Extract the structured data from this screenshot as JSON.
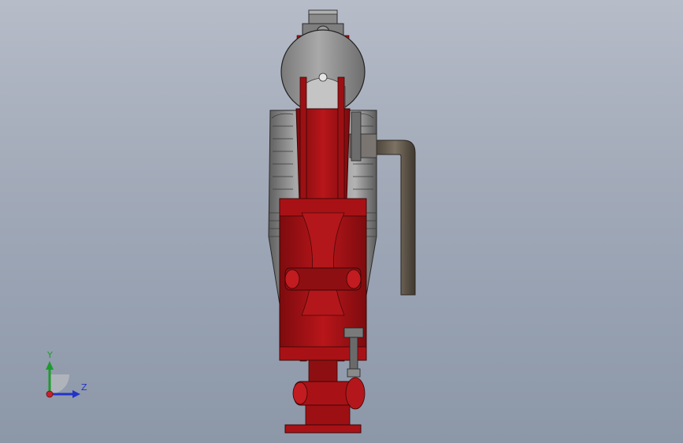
{
  "view": {
    "background_top": "#b6bcc8",
    "background_bottom": "#8c97a8"
  },
  "model": {
    "colors": {
      "frame_red": "#a81216",
      "frame_red_dark": "#6e0a0c",
      "frame_red_light": "#c8262a",
      "gray_body": "#8e8e8e",
      "gray_light": "#c9c9c9",
      "gray_dark": "#4f4f4f",
      "pipe": "#6b6256",
      "pipe_dark": "#3b352e"
    },
    "icons": [
      "coordinate-triad-icon"
    ]
  },
  "triad": {
    "y_label": "Y",
    "z_label": "Z",
    "y_color": "#1f9a2e",
    "z_color": "#2233c8",
    "x_color": "#c8202a"
  }
}
